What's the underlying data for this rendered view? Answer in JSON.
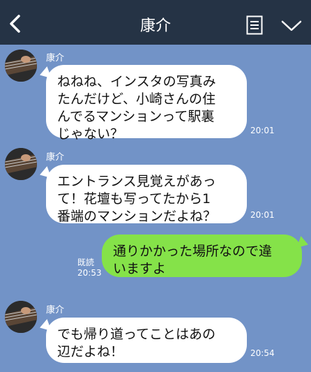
{
  "header": {
    "title": "康介",
    "back_icon": "chevron-left-icon",
    "menu_icon": "note-icon",
    "more_icon": "chevron-down-icon",
    "bg_color": "#253345"
  },
  "chat_bg_color": "#7293c7",
  "messages": [
    {
      "type": "received",
      "sender": "康介",
      "text": "ねねね、インスタの写真み\nたんだけど、小崎さんの住\nんでるマンションって駅裏\nじゃない？",
      "time": "20:01"
    },
    {
      "type": "received",
      "sender": "康介",
      "text": "エントランス見覚えがあっ\nて！花壇も写ってたから1\n番端のマンションだよね？",
      "time": "20:01"
    },
    {
      "type": "sent",
      "text": "通りかかった場所なので違\nいますよ",
      "read_label": "既読",
      "time": "20:53"
    },
    {
      "type": "received",
      "sender": "康介",
      "text": "でも帰り道ってことはあの\n辺だよね！",
      "time": "20:54"
    }
  ]
}
